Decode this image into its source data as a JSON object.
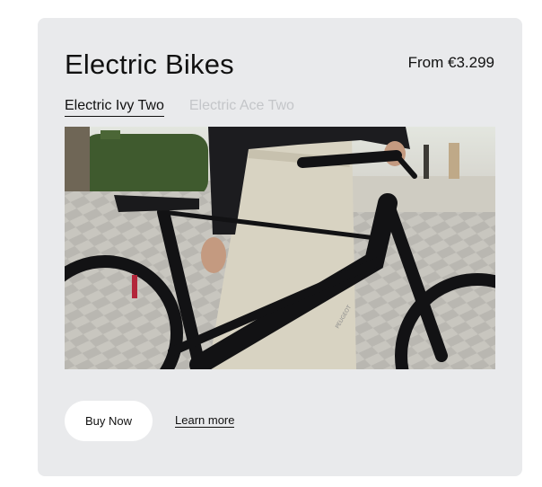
{
  "card": {
    "title": "Electric Bikes",
    "price": "From €3.299"
  },
  "tabs": [
    {
      "label": "Electric Ivy Two",
      "active": true
    },
    {
      "label": "Electric Ace Two",
      "active": false
    }
  ],
  "image": {
    "alt": "Electric bike photo",
    "frame_text": "PEUGEOT"
  },
  "actions": {
    "primary_label": "Buy Now",
    "secondary_label": "Learn more"
  },
  "colors": {
    "card_bg": "#e9eaec",
    "text": "#111111",
    "inactive_tab": "#c4c6c9",
    "button_bg": "#ffffff"
  }
}
